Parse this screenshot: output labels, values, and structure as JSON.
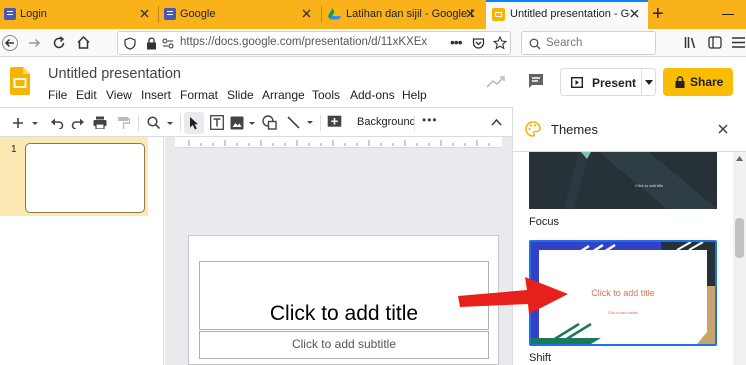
{
  "browser": {
    "tabs": [
      {
        "title": "Login"
      },
      {
        "title": "Google"
      },
      {
        "title": "Latihan dan sijil - Google Dri"
      },
      {
        "title": "Untitled presentation - Goog"
      }
    ],
    "new_tab": "+",
    "url": "https://docs.google.com/presentation/d/11xKXEx",
    "search_placeholder": "Search"
  },
  "doc": {
    "title": "Untitled presentation",
    "present_label": "Present",
    "share_label": "Share",
    "menu": [
      "File",
      "Edit",
      "View",
      "Insert",
      "Format",
      "Slide",
      "Arrange",
      "Tools",
      "Add-ons",
      "Help"
    ]
  },
  "toolbar": {
    "background_label": "Background"
  },
  "filmstrip": {
    "slide_number": "1"
  },
  "slide": {
    "title_placeholder": "Click to add title",
    "subtitle_placeholder": "Click to add subtitle"
  },
  "themes": {
    "heading": "Themes",
    "items": [
      {
        "name": "Focus",
        "preview_text": "Click to add title"
      },
      {
        "name": "Shift",
        "preview_title": "Click to add title",
        "preview_subtitle": "Click to add subtitle"
      }
    ]
  },
  "colors": {
    "tabstrip": "#f9b21a",
    "share": "#fbbc04",
    "accent_blue": "#1a73e8",
    "arrow": "#e8201c"
  }
}
